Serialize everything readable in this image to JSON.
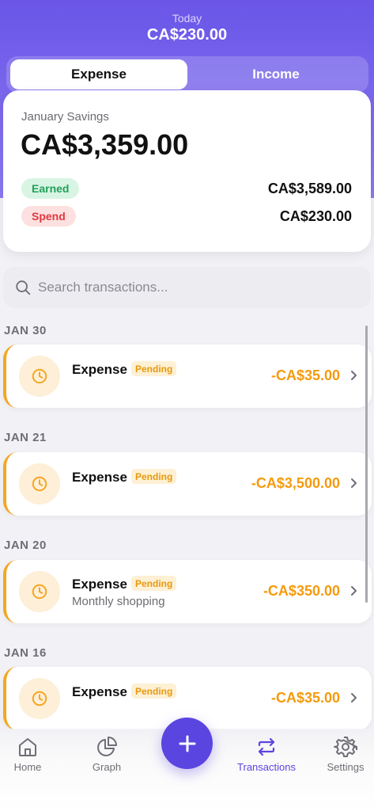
{
  "header": {
    "today_label": "Today",
    "today_amount": "CA$230.00",
    "segments": [
      {
        "label": "Expense",
        "active": true
      },
      {
        "label": "Income",
        "active": false
      }
    ]
  },
  "savings": {
    "label": "January Savings",
    "amount": "CA$3,359.00",
    "earned_label": "Earned",
    "earned_value": "CA$3,589.00",
    "spend_label": "Spend",
    "spend_value": "CA$230.00"
  },
  "search": {
    "placeholder": "Search transactions...",
    "value": ""
  },
  "groups": [
    {
      "date": "JAN 30",
      "tx": {
        "title": "Expense",
        "status": "Pending",
        "subtitle": "",
        "amount": "-CA$35.00"
      }
    },
    {
      "date": "JAN 21",
      "tx": {
        "title": "Expense",
        "status": "Pending",
        "subtitle": "",
        "amount": "-CA$3,500.00"
      }
    },
    {
      "date": "JAN 20",
      "tx": {
        "title": "Expense",
        "status": "Pending",
        "subtitle": "Monthly shopping",
        "amount": "-CA$350.00"
      }
    },
    {
      "date": "JAN 16",
      "tx": {
        "title": "Expense",
        "status": "Pending",
        "subtitle": "",
        "amount": "-CA$35.00"
      }
    }
  ],
  "tabs": [
    {
      "label": "Home",
      "icon": "home-icon",
      "active": false
    },
    {
      "label": "Graph",
      "icon": "pie-chart-icon",
      "active": false
    },
    {
      "label": "Transactions",
      "icon": "transfer-arrows-icon",
      "active": true
    },
    {
      "label": "Settings",
      "icon": "gear-icon",
      "active": false
    }
  ],
  "fab": {
    "icon": "plus-icon"
  },
  "colors": {
    "accent": "#5b45e0",
    "header_top": "#6a55e8",
    "expense_amount": "#f59a0d",
    "pending_badge_bg": "#fdf0d4",
    "earned_green": "#22a05a",
    "spend_red": "#e0383e"
  }
}
